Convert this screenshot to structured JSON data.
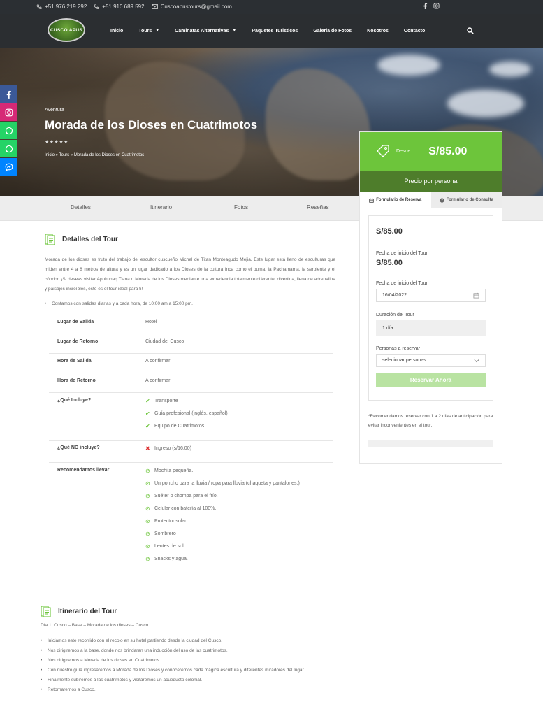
{
  "topbar": {
    "phone1": "+51 976 219 292",
    "phone2": "+51 910 689 592",
    "email": "Cuscoapustours@gmail.com"
  },
  "logo": {
    "text": "CUSCO APUS"
  },
  "menu": {
    "items": [
      {
        "label": "Inicio"
      },
      {
        "label": "Tours"
      },
      {
        "label": "Caminatas Alternativas"
      },
      {
        "label": "Paquetes Turisticos"
      },
      {
        "label": "Galeria de Fotos"
      },
      {
        "label": "Nosotros"
      },
      {
        "label": "Contacto"
      }
    ]
  },
  "hero": {
    "category": "Aventura",
    "title": "Morada de los Dioses en Cuatrimotos",
    "stars": "★★★★★",
    "breadcrumb": "Inicio » Tours » Morada de los Dioses en Cuatrimotos"
  },
  "tabs": [
    "Detalles",
    "Itinerario",
    "Fotos",
    "Reseñas"
  ],
  "price_card": {
    "desde": "Desde",
    "amount": "S/85.00",
    "sub": "Precio por persona",
    "tab_reserva": "Formulario de Reserva",
    "tab_consulta": "Formulario de Consulta",
    "price": "S/85.00",
    "fecha_label": "Fecha de inicio del Tour",
    "fecha_price": "S/85.00",
    "fecha_input_label": "Fecha de inicio del Tour",
    "fecha_value": "16/04/2022",
    "duracion_label": "Duración del Tour",
    "duracion_value": "1 día",
    "personas_label": "Personas a reservar",
    "personas_value": "selecionar personas",
    "reservar": "Reservar Ahora",
    "note": "*Recomendamos reservar con 1 a 2 días de anticipación para evitar inconvenientes en el tour."
  },
  "detalles": {
    "title": "Detalles del Tour",
    "paragraph": "Morada de los dioses es fruto del trabajo del escultor cuscueño Michel de Titan Monteagudo Mejia. Este lugar está lleno de esculturas que miden entre 4 a 8 metros de altura y es un lugar dedicado a los Dioses de la cultura Inca como el puma, la Pachamama, la serpiente y el cóndor. ¡Si deseas visitar Apukunaq Tiana o Morada de los Dioses mediante una experiencia totalmente diferente, divertida, llena de adrenalina y paisajes increíbles, este es el tour ideal para ti!",
    "bullet": "Contamos con salidas diarias y a cada hora, de 10:00 am a 15:00 pm.",
    "rows": [
      {
        "k": "Lugar de Salida",
        "v": "Hotel"
      },
      {
        "k": "Lugar de Retorno",
        "v": "Ciudad del Cusco"
      },
      {
        "k": "Hora de Salida",
        "v": "A confirmar"
      },
      {
        "k": "Hora de Retorno",
        "v": "A confirmar"
      }
    ],
    "incluye_label": "¿Qué Incluye?",
    "incluye": [
      "Transporte",
      "Guía profesional (inglés, español)",
      "Equipo de Cuatrimotos."
    ],
    "no_incluye_label": "¿Qué NO incluye?",
    "no_incluye": [
      "Ingreso (s/16.00)"
    ],
    "llevar_label": "Recomendamos llevar",
    "llevar": [
      "Mochila pequeña.",
      "Un poncho para la lluvia / ropa para lluvia (chaqueta y pantalones.)",
      "Suéter o chompa para el frío.",
      "Celular con batería al 100%.",
      "Protector solar.",
      "Sombrero",
      "Lentes de sol",
      "Snacks y agua."
    ]
  },
  "itinerario": {
    "title": "Itinerario del Tour",
    "day": "Día 1: Cusco – Base – Morada de los dioses – Cusco",
    "items": [
      "Iniciamos este recorrido con el recojo en su hotel partiendo desde la ciudad del Cusco.",
      "Nos dirigiremos a la base, donde nos brindaran una inducción del uso de las cuatrimotos.",
      "Nos dirigiremos a Morada de los dioses en Cuatrimotos.",
      "Con nuestro guía ingresaremos a Morada de los Dioses y conoceremos cada mágica escultura y diferentes miradores del lugar.",
      "Finalmente subiremos a las cuatrimotos y visitaremos un acueducto colonial.",
      "Retornaremos a Cusco."
    ]
  },
  "colors": {
    "accent": "#6dc53b",
    "accent_dark": "#4e7d2b",
    "button_light": "#b9e3a2"
  }
}
